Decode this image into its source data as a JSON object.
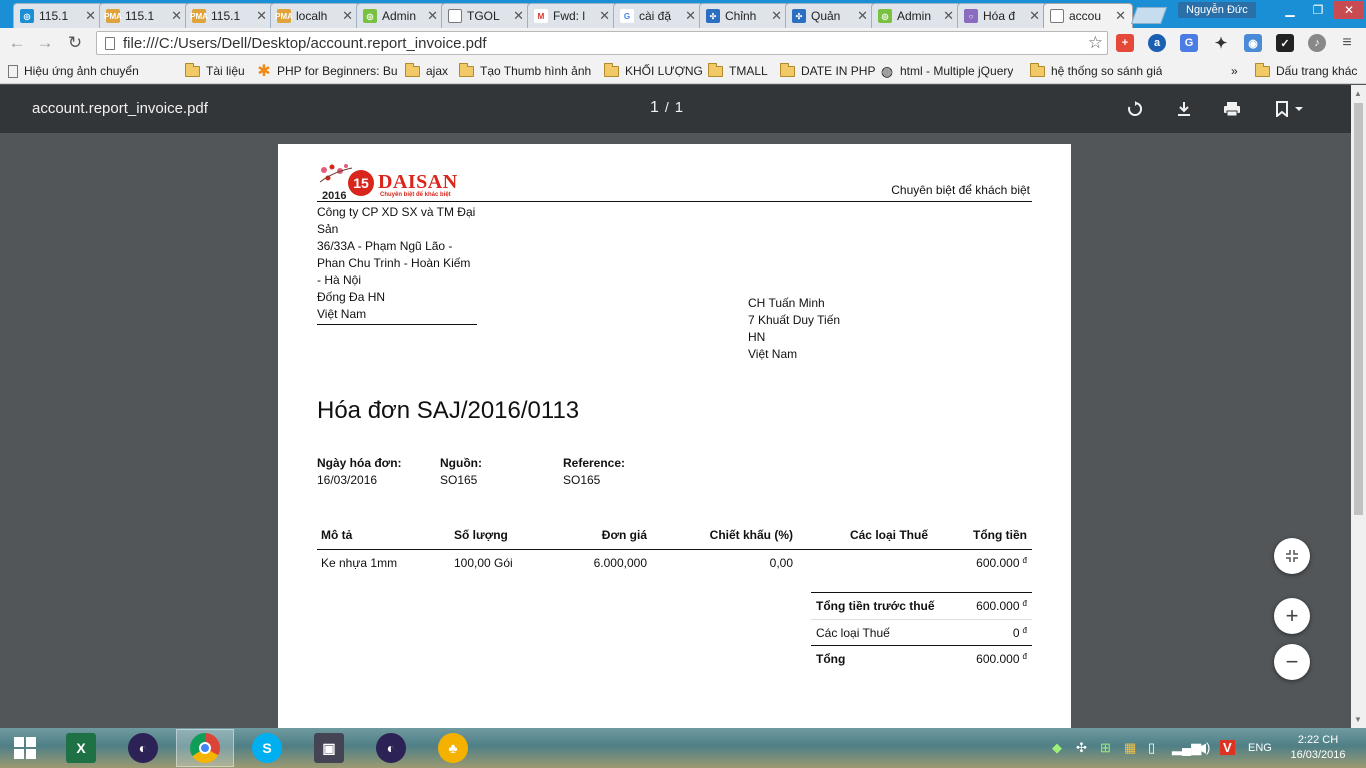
{
  "browser": {
    "tabs": [
      {
        "label": "115.1",
        "favicon": "globe-icon"
      },
      {
        "label": "115.1",
        "favicon": "pma-icon"
      },
      {
        "label": "115.1",
        "favicon": "pma-icon"
      },
      {
        "label": "localh",
        "favicon": "pma-icon"
      },
      {
        "label": "Admin",
        "favicon": "admin-icon"
      },
      {
        "label": "TGOL",
        "favicon": "page-icon"
      },
      {
        "label": "Fwd: l",
        "favicon": "gmail-icon"
      },
      {
        "label": "cài đặ",
        "favicon": "google-icon"
      },
      {
        "label": "Chỉnh",
        "favicon": "grid-icon"
      },
      {
        "label": "Quản",
        "favicon": "grid-icon"
      },
      {
        "label": "Admin",
        "favicon": "admin-icon"
      },
      {
        "label": "Hóa đ",
        "favicon": "circle-icon"
      },
      {
        "label": "accou",
        "favicon": "page-icon",
        "active": true
      }
    ],
    "user_name": "Nguyễn Đức",
    "url": "file:///C:/Users/Dell/Desktop/account.report_invoice.pdf",
    "bookmarks": [
      {
        "label": "Hiệu ứng ảnh chuyển",
        "icon": "page-icon"
      },
      {
        "label": "Tài liệu",
        "icon": "folder-icon"
      },
      {
        "label": "PHP for Beginners: Bu",
        "icon": "asterisk-icon"
      },
      {
        "label": "ajax",
        "icon": "folder-icon"
      },
      {
        "label": "Tạo Thumb hình ảnh",
        "icon": "folder-icon"
      },
      {
        "label": "KHỐI LƯỢNG",
        "icon": "folder-icon"
      },
      {
        "label": "TMALL",
        "icon": "folder-icon"
      },
      {
        "label": "DATE IN PHP",
        "icon": "folder-icon"
      },
      {
        "label": "html - Multiple jQuery",
        "icon": "globe-icon"
      },
      {
        "label": "hệ thống so sánh giá",
        "icon": "folder-icon"
      }
    ],
    "bookmarks_overflow": "»",
    "other_bookmarks": "Dấu trang khác"
  },
  "pdf_viewer": {
    "title": "account.report_invoice.pdf",
    "current_page": "1",
    "page_separator": "/",
    "total_pages": "1",
    "fit_icon": "⤡",
    "zoom_in": "+",
    "zoom_out": "−"
  },
  "invoice": {
    "brand": "DAISAN",
    "logo_number": "15",
    "logo_year": "2016",
    "logo_slogan": "Chuyên biệt để khác biệt",
    "tagline": "Chuyên biệt để khách biệt",
    "company_lines": [
      "Công ty CP XD SX và TM Đại",
      "Sản",
      "36/33A - Phạm Ngũ Lão -",
      "Phan Chu Trinh - Hoàn Kiếm",
      "- Hà Nội",
      "Đống Đa HN",
      "Việt Nam"
    ],
    "customer_lines": [
      "CH Tuấn Minh",
      "7 Khuất Duy Tiến",
      "HN",
      "Việt Nam"
    ],
    "title": "Hóa đơn SAJ/2016/0113",
    "meta": [
      {
        "label": "Ngày hóa đơn:",
        "value": "16/03/2016"
      },
      {
        "label": "Nguồn:",
        "value": "SO165"
      },
      {
        "label": "Reference:",
        "value": "SO165"
      }
    ],
    "columns": [
      "Mô tả",
      "Số lượng",
      "Đơn giá",
      "Chiết khấu (%)",
      "Các loại Thuế",
      "Tổng tiền"
    ],
    "rows": [
      {
        "description": "Ke nhựa 1mm",
        "quantity": "100,00 Gói",
        "unit_price": "6.000,000",
        "discount": "0,00",
        "taxes": "",
        "amount": "600.000",
        "currency": "đ"
      }
    ],
    "totals": [
      {
        "label": "Tổng tiền trước thuế",
        "value": "600.000",
        "currency": "đ",
        "bold": true
      },
      {
        "label": "Các loại Thuế",
        "value": "0",
        "currency": "đ",
        "bold": false
      },
      {
        "label": "Tổng",
        "value": "600.000",
        "currency": "đ",
        "bold": true
      }
    ]
  },
  "taskbar": {
    "language": "ENG",
    "time": "2:22 CH",
    "date": "16/03/2016"
  }
}
